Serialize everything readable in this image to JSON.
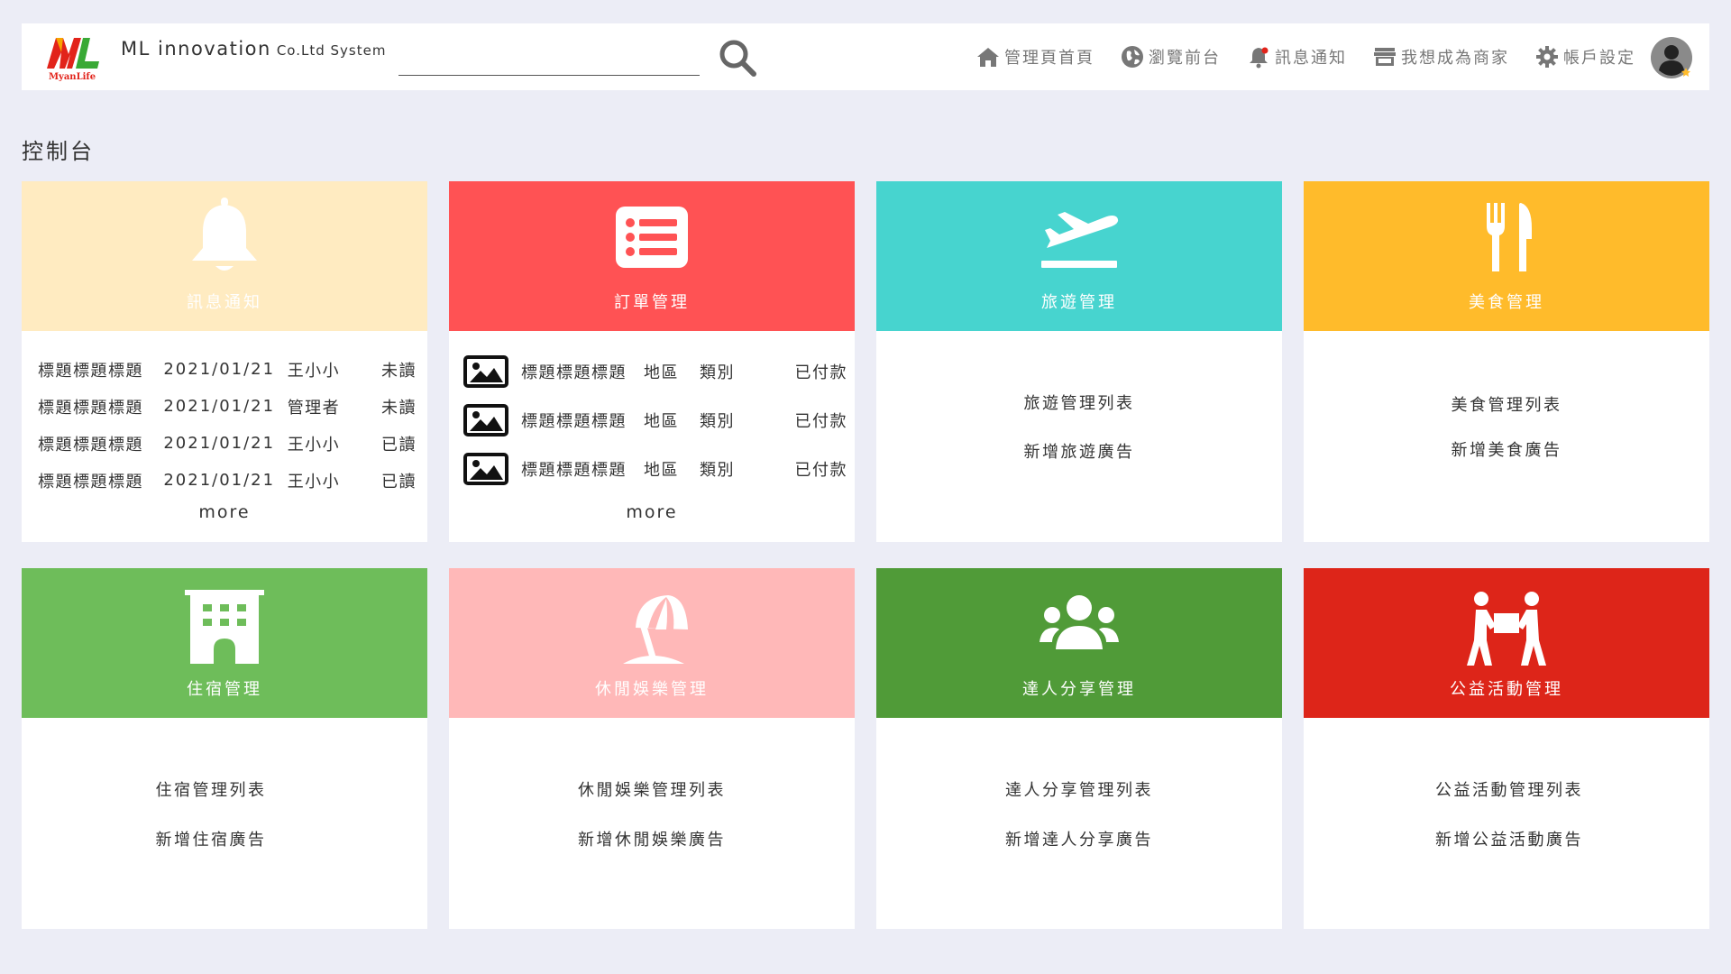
{
  "header": {
    "brand_name": "ML innovation",
    "brand_suffix": "Co.Ltd System",
    "logo_text": "MyanLife",
    "search": {
      "value": "",
      "placeholder": ""
    },
    "nav": [
      {
        "label": "管理頁首頁",
        "icon": "home-icon"
      },
      {
        "label": "瀏覽前台",
        "icon": "globe-icon"
      },
      {
        "label": "訊息通知",
        "icon": "bell-icon"
      },
      {
        "label": "我想成為商家",
        "icon": "store-icon"
      },
      {
        "label": "帳戶設定",
        "icon": "gear-icon"
      }
    ]
  },
  "page": {
    "title": "控制台"
  },
  "cards": {
    "notifications": {
      "title": "訊息通知",
      "color": "#ffebc1",
      "rows": [
        {
          "title": "標題標題標題",
          "date": "2021/01/21",
          "user": "王小小",
          "status": "未讀"
        },
        {
          "title": "標題標題標題",
          "date": "2021/01/21",
          "user": "管理者",
          "status": "未讀"
        },
        {
          "title": "標題標題標題",
          "date": "2021/01/21",
          "user": "王小小",
          "status": "已讀"
        },
        {
          "title": "標題標題標題",
          "date": "2021/01/21",
          "user": "王小小",
          "status": "已讀"
        }
      ],
      "more": "more"
    },
    "orders": {
      "title": "訂單管理",
      "color": "#ff5254",
      "rows": [
        {
          "title": "標題標題標題",
          "region": "地區",
          "category": "類別",
          "status": "已付款"
        },
        {
          "title": "標題標題標題",
          "region": "地區",
          "category": "類別",
          "status": "已付款"
        },
        {
          "title": "標題標題標題",
          "region": "地區",
          "category": "類別",
          "status": "已付款"
        }
      ],
      "more": "more"
    },
    "travel": {
      "title": "旅遊管理",
      "color": "#47d4cf",
      "links": [
        "旅遊管理列表",
        "新增旅遊廣告"
      ]
    },
    "food": {
      "title": "美食管理",
      "color": "#ffbb2b",
      "links": [
        "美食管理列表",
        "新增美食廣告"
      ]
    },
    "lodging": {
      "title": "住宿管理",
      "color": "#6ebd5a",
      "links": [
        "住宿管理列表",
        "新增住宿廣告"
      ]
    },
    "leisure": {
      "title": "休閒娛樂管理",
      "color": "#ffb8b8",
      "links": [
        "休閒娛樂管理列表",
        "新增休閒娛樂廣告"
      ]
    },
    "experts": {
      "title": "達人分享管理",
      "color": "#509b38",
      "links": [
        "達人分享管理列表",
        "新增達人分享廣告"
      ]
    },
    "charity": {
      "title": "公益活動管理",
      "color": "#dd2519",
      "links": [
        "公益活動管理列表",
        "新增公益活動廣告"
      ]
    }
  }
}
